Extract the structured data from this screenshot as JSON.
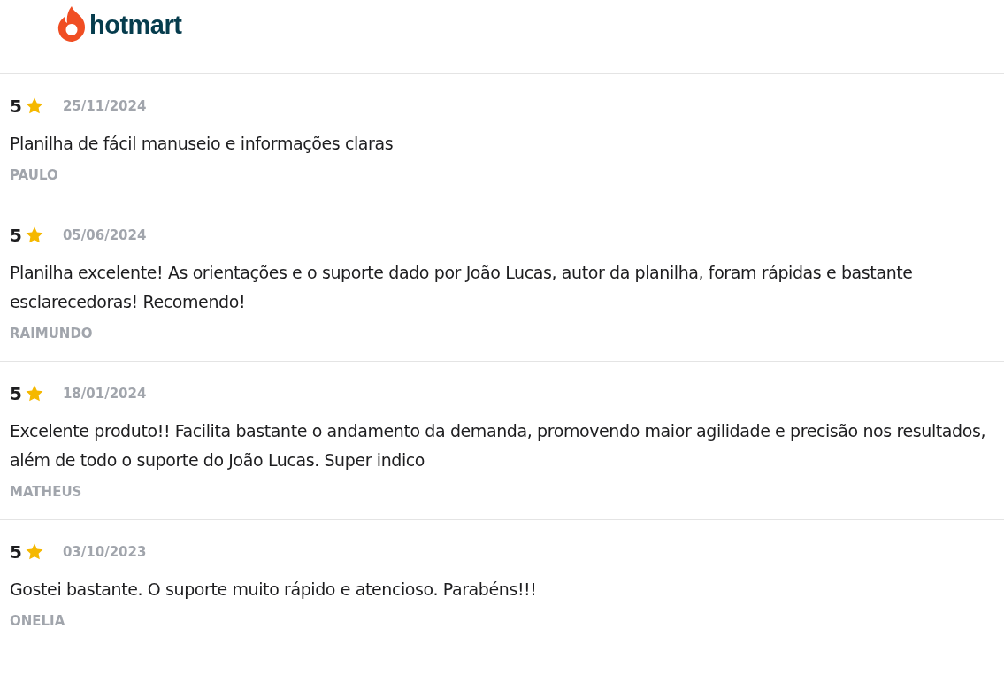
{
  "header": {
    "logo_text": "hotmart"
  },
  "reviews": [
    {
      "rating": "5",
      "date": "25/11/2024",
      "text": "Planilha de fácil manuseio e informações claras",
      "author": "PAULO"
    },
    {
      "rating": "5",
      "date": "05/06/2024",
      "text": "Planilha excelente! As orientações e o suporte dado por João Lucas, autor da planilha, foram rápidas e bastante esclarecedoras! Recomendo!",
      "author": "RAIMUNDO"
    },
    {
      "rating": "5",
      "date": "18/01/2024",
      "text": "Excelente produto!! Facilita bastante o andamento da demanda, promovendo maior agilidade e precisão nos resultados, além de todo o suporte do João Lucas. Super indico",
      "author": "MATHEUS"
    },
    {
      "rating": "5",
      "date": "03/10/2023",
      "text": "Gostei bastante. O suporte muito rápido e atencioso. Parabéns!!!",
      "author": "ONELIA"
    }
  ]
}
